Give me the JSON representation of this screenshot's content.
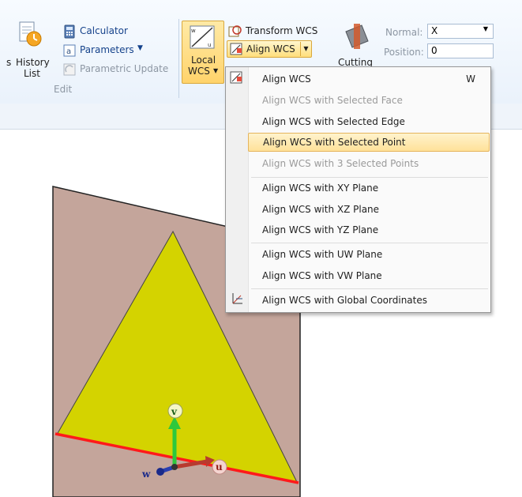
{
  "ribbon": {
    "history_label_line1": "History",
    "history_label_line2": "List",
    "truncated_left": "s",
    "calculator_label": "Calculator",
    "parameters_label": "Parameters",
    "parametric_update_label": "Parametric Update",
    "edit_group_label": "Edit",
    "local_wcs_line1": "Local",
    "local_wcs_line2": "WCS",
    "transform_wcs_label": "Transform WCS",
    "align_wcs_label": "Align WCS",
    "cutting_label": "Cutting",
    "normal_label": "Normal:",
    "normal_value": "X",
    "position_label": "Position:",
    "position_value": "0"
  },
  "menu": {
    "items": [
      {
        "label": "Align WCS",
        "shortcut": "W",
        "enabled": true,
        "icon": "align-wcs-icon"
      },
      {
        "label": "Align WCS with Selected Face",
        "enabled": false
      },
      {
        "label": "Align WCS with Selected Edge",
        "enabled": true
      },
      {
        "label": "Align WCS with Selected Point",
        "enabled": true,
        "highlighted": true
      },
      {
        "label": "Align WCS with 3 Selected Points",
        "enabled": false
      },
      {
        "label": "Align WCS with XY Plane",
        "enabled": true
      },
      {
        "label": "Align WCS with XZ Plane",
        "enabled": true
      },
      {
        "label": "Align WCS with YZ Plane",
        "enabled": true
      },
      {
        "label": "Align WCS with UW Plane",
        "enabled": true
      },
      {
        "label": "Align WCS with VW Plane",
        "enabled": true
      },
      {
        "label": "Align WCS with Global Coordinates",
        "enabled": true,
        "icon": "global-coordinates-icon"
      }
    ]
  },
  "viewport": {
    "axis_v": "v",
    "axis_u": "u",
    "axis_w": "w",
    "plane_color": "#c4a59b",
    "triangle_color": "#d4d300",
    "edge_color": "#ff1a1a"
  },
  "ui_colors": {
    "ribbon_text": "#15428b",
    "highlight": "#ffe199"
  }
}
